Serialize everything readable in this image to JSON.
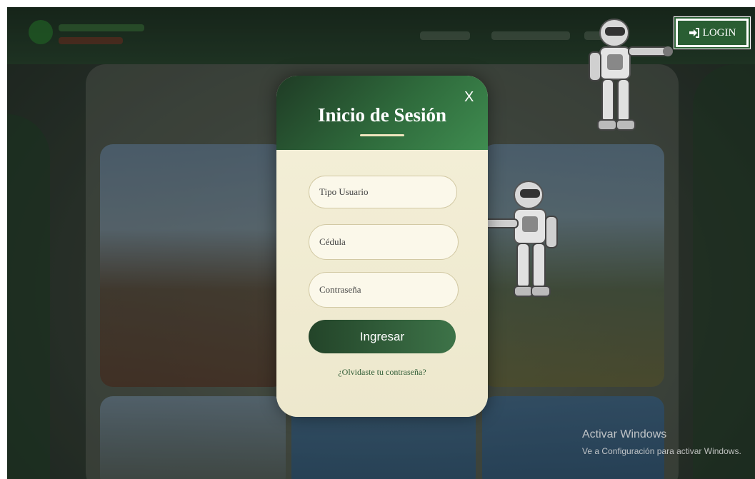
{
  "header": {
    "login_label": "LOGIN",
    "login_icon": "sign-in-icon"
  },
  "modal": {
    "title": "Inicio de Sesión",
    "close_label": "X",
    "fields": {
      "user_type_placeholder": "Tipo Usuario",
      "id_placeholder": "Cédula",
      "password_placeholder": "Contraseña"
    },
    "submit_label": "Ingresar",
    "forgot_label": "¿Olvidaste tu contraseña?"
  },
  "watermark": {
    "title": "Activar Windows",
    "subtitle": "Ve a Configuración para activar Windows."
  },
  "colors": {
    "brand_green": "#2f6b3c",
    "modal_bg": "#f1ecd2",
    "login_green": "#2a5e33"
  }
}
